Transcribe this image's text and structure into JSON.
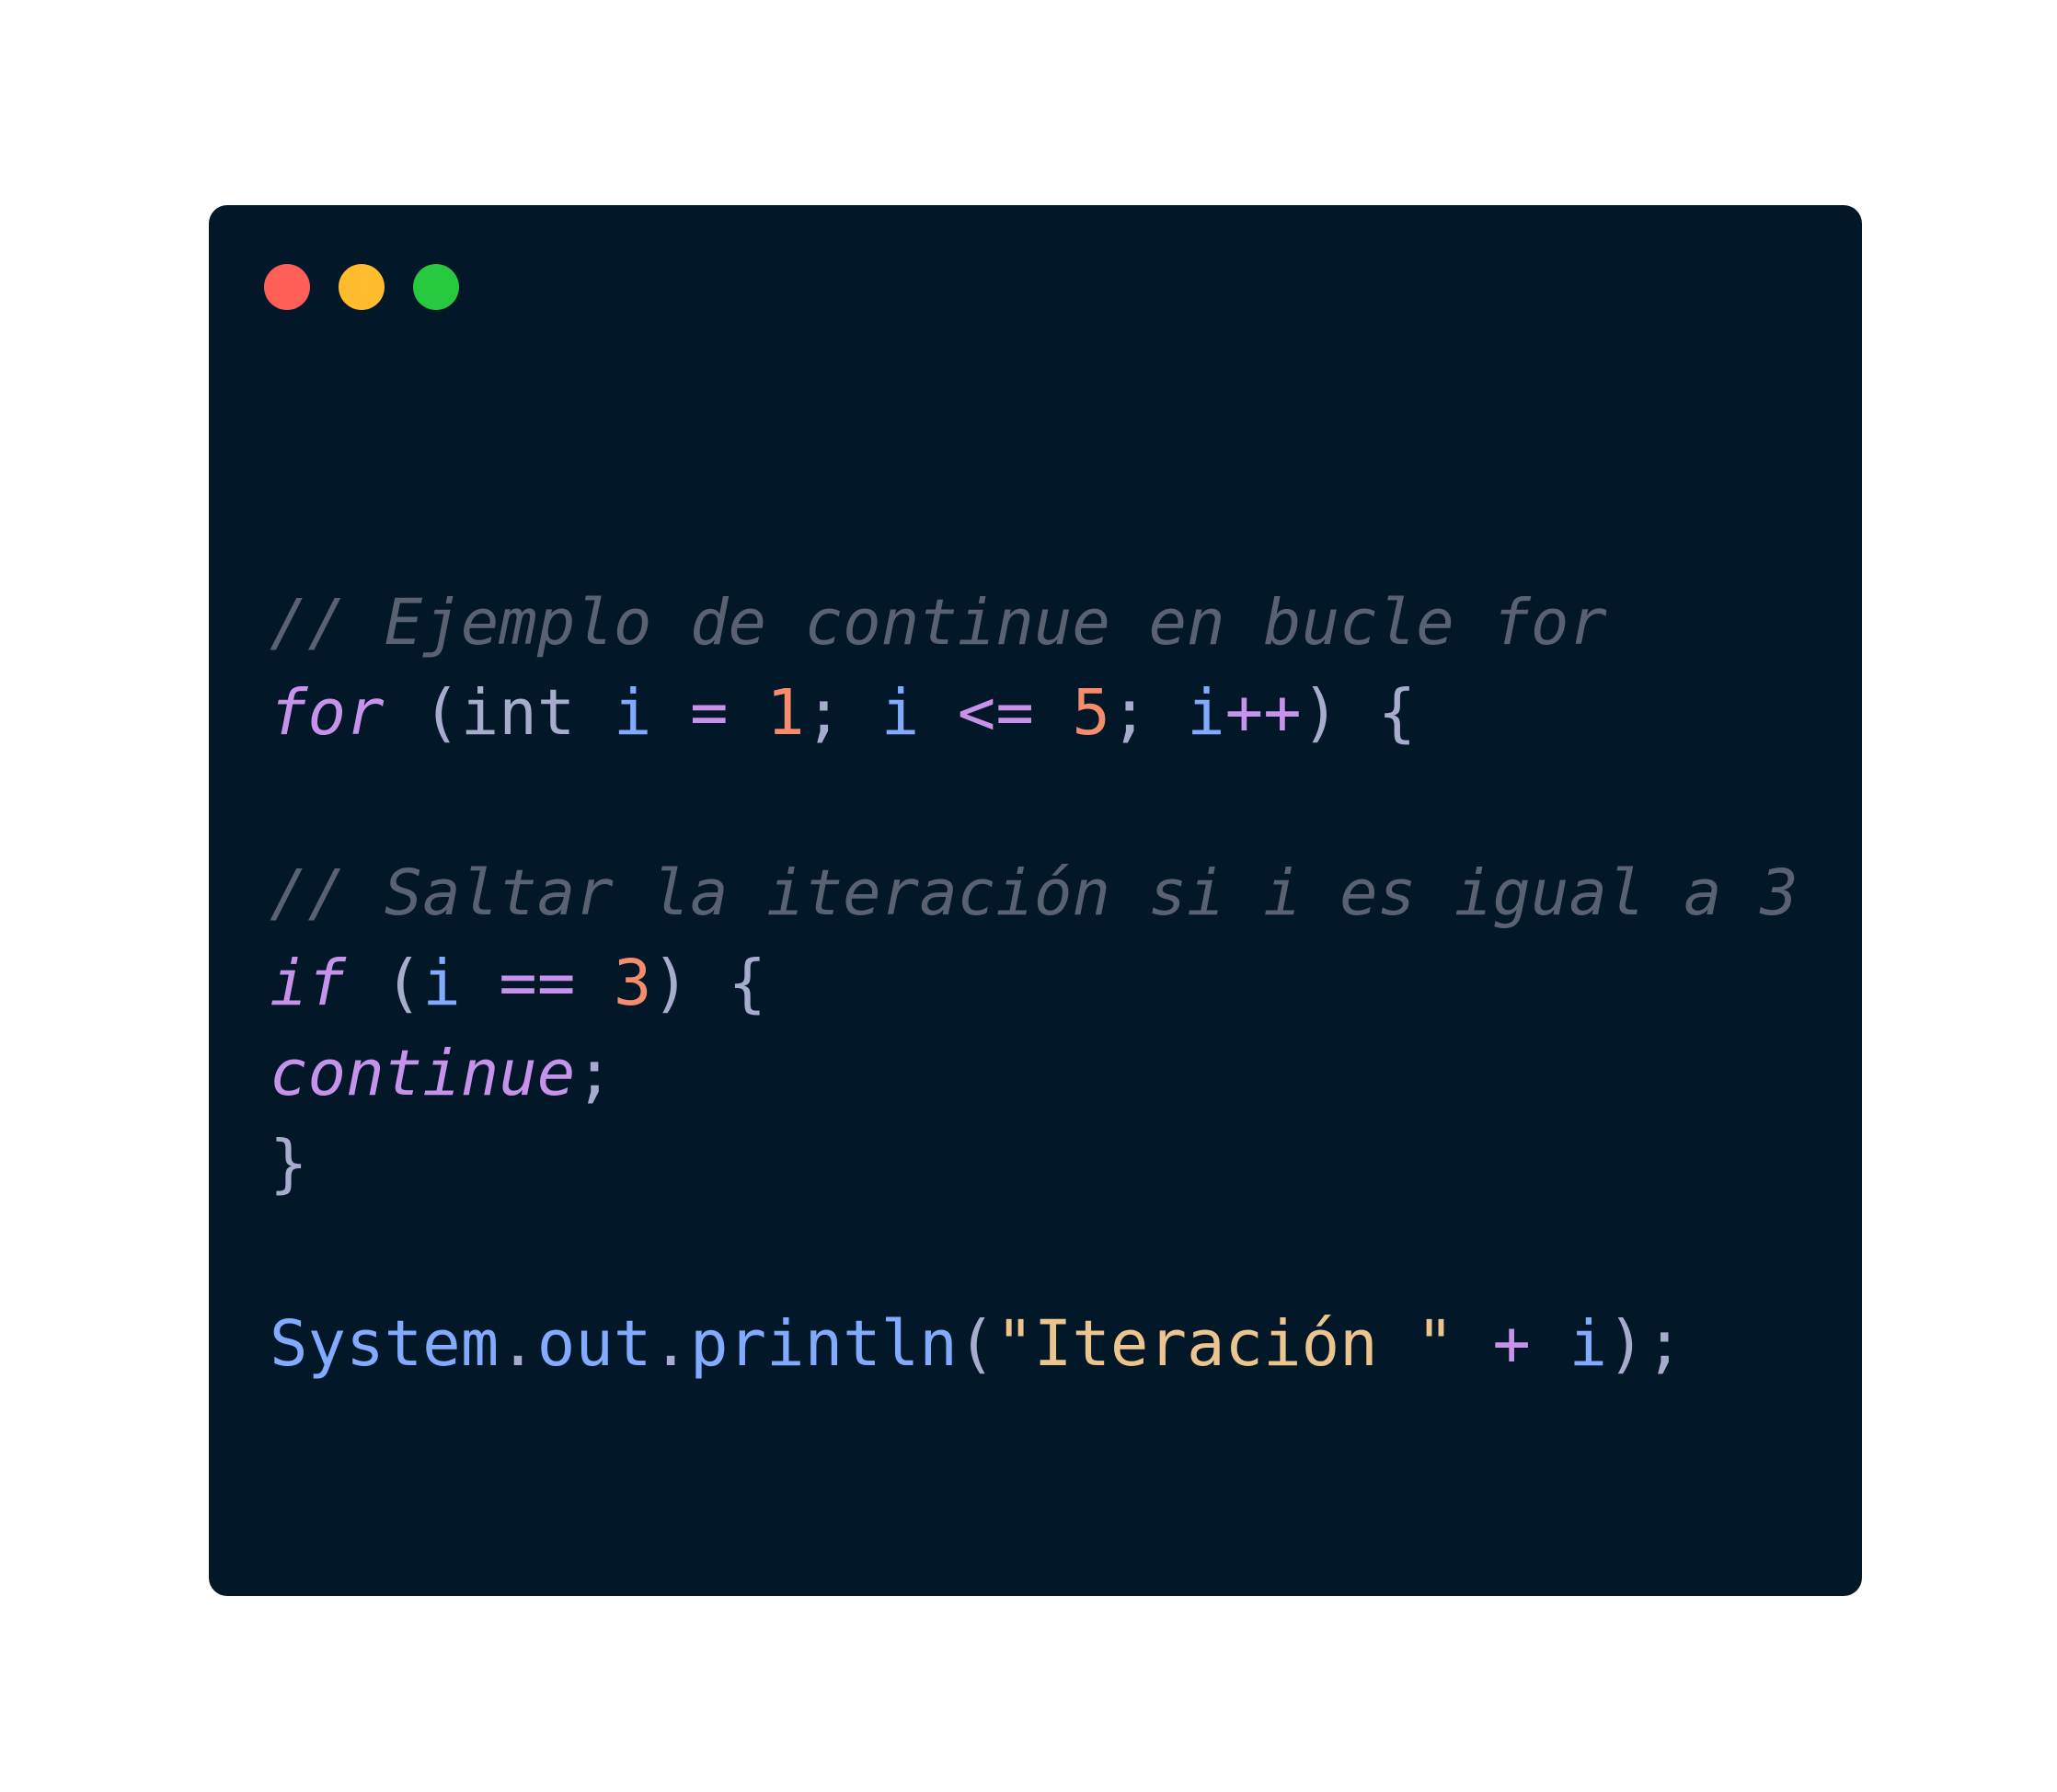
{
  "window": {
    "controls": {
      "close_color": "#ff5f56",
      "minimize_color": "#ffbd2e",
      "maximize_color": "#27c93f"
    }
  },
  "code": {
    "language": "java",
    "lines": [
      "// Ejemplo de continue en bucle for",
      "for (int i = 1; i <= 5; i++) {",
      "",
      "// Saltar la iteración si i es igual a 3",
      "if (i == 3) {",
      "continue;",
      "}",
      "",
      "System.out.println(\"Iteración \" + i);"
    ],
    "tokens": {
      "l1_comment": "// Ejemplo de continue en bucle for",
      "l2_for": "for",
      "l2_open": " (",
      "l2_int": "int",
      "l2_sp": " ",
      "l2_i1": "i",
      "l2_eq": " = ",
      "l2_one": "1",
      "l2_semi1": "; ",
      "l2_i2": "i",
      "l2_le": " <= ",
      "l2_five": "5",
      "l2_semi2": "; ",
      "l2_i3": "i",
      "l2_inc": "++",
      "l2_close": ") {",
      "l4_comment": "// Saltar la iteración si i es igual a 3",
      "l5_if": "if",
      "l5_open": " (",
      "l5_i": "i",
      "l5_eqeq": " == ",
      "l5_three": "3",
      "l5_close": ") {",
      "l6_continue": "continue",
      "l6_semi": ";",
      "l7_brace": "}",
      "l9_system": "System",
      "l9_dot1": ".",
      "l9_out": "out",
      "l9_dot2": ".",
      "l9_println": "println",
      "l9_open": "(",
      "l9_str": "\"Iteración \"",
      "l9_plus": " + ",
      "l9_i": "i",
      "l9_close": ");"
    }
  }
}
